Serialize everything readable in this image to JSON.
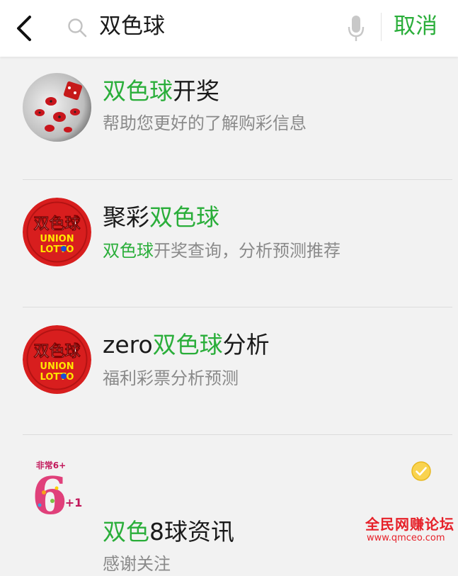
{
  "header": {
    "query": "双色球",
    "cancel_label": "取消"
  },
  "results": [
    {
      "title_highlight": "双色球",
      "title_rest": "开奖",
      "description": "帮助您更好的了解购彩信息",
      "avatar_icon": "ladybug-photo-avatar"
    },
    {
      "title_prefix": "聚彩",
      "title_highlight": "双色球",
      "desc_highlight": "双色球",
      "desc_rest": "开奖查询，分析预测推荐",
      "avatar_icon": "union-lotto-logo",
      "logo_text_cn": "双色球",
      "logo_text_1": "UNION",
      "logo_text_2": "LOTTO"
    },
    {
      "title_prefix": "zero",
      "title_highlight": "双色球",
      "title_rest": "分析",
      "description": "福利彩票分析预测",
      "avatar_icon": "union-lotto-logo",
      "logo_text_cn": "双色球",
      "logo_text_1": "UNION",
      "logo_text_2": "LOTTO"
    },
    {
      "title_highlight": "双色",
      "title_rest": "8球资讯",
      "description": "感谢关注",
      "avatar_icon": "six-plus-one-logo",
      "logo_text_small": "非常6+",
      "logo_text_big": "6",
      "logo_text_plus": "+1",
      "verified_icon": "verified-check-icon"
    }
  ],
  "watermark": {
    "line1": "全民网赚论坛",
    "line2": "www.qmceo.com"
  },
  "colors": {
    "highlight": "#2aae3a",
    "background": "#f2f2f2",
    "logo_red": "#d81e1e"
  }
}
